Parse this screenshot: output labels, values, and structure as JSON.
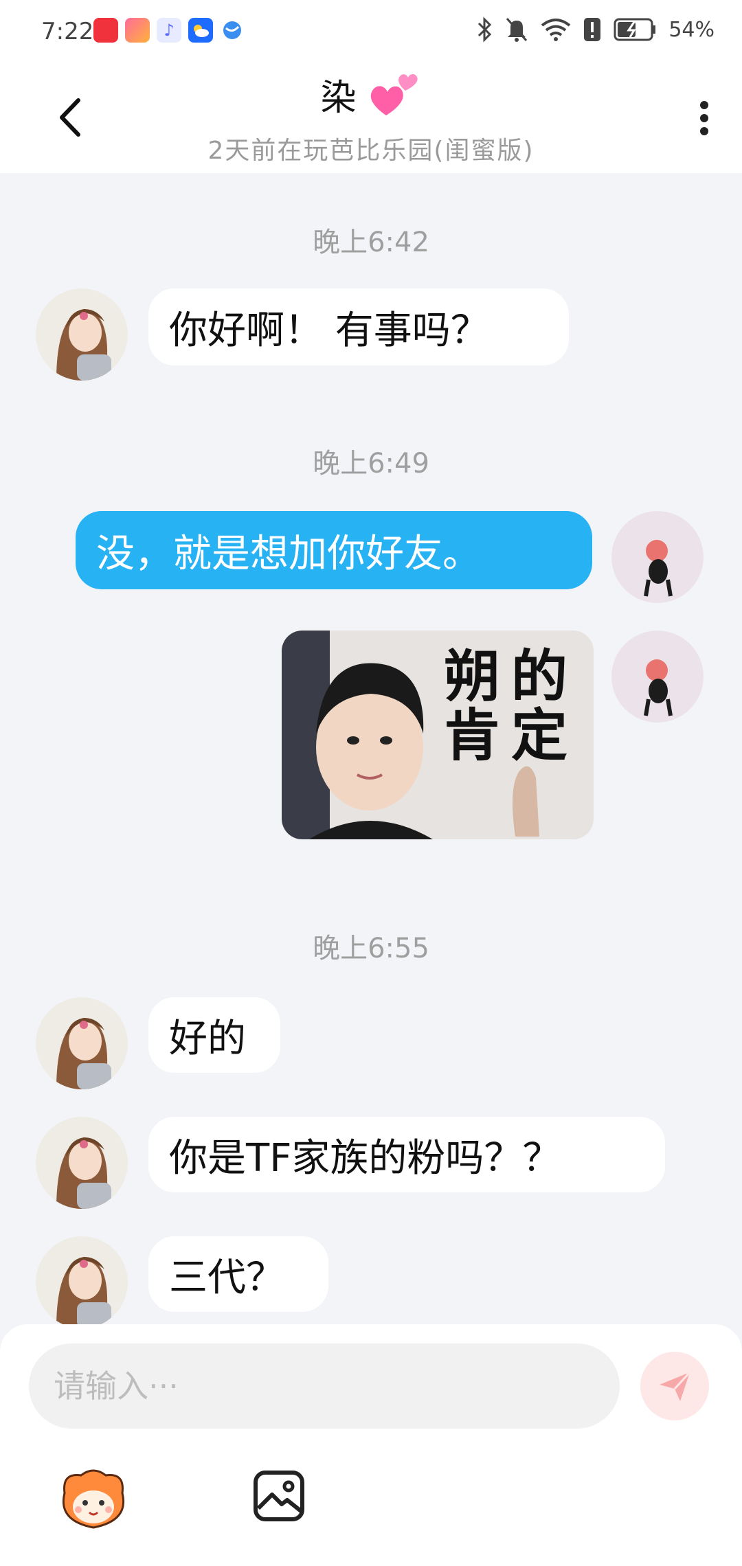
{
  "status_bar": {
    "time": "7:22",
    "battery": "54%",
    "icons": [
      "app-notif-icon",
      "gift-icon",
      "music-icon",
      "weather-icon",
      "browser-icon",
      "bluetooth-icon",
      "mute-icon",
      "wifi-icon",
      "alert-icon",
      "battery-icon"
    ]
  },
  "header": {
    "title": "染",
    "subtitle": "2天前在玩芭比乐园(闺蜜版)"
  },
  "messages": [
    {
      "type": "timestamp",
      "text": "晚上6:42"
    },
    {
      "type": "text",
      "direction": "in",
      "text": "你好啊！ 有事吗？"
    },
    {
      "type": "timestamp",
      "text": "晚上6:49"
    },
    {
      "type": "text",
      "direction": "out",
      "text": "没，就是想加你好友。"
    },
    {
      "type": "sticker",
      "direction": "out",
      "text_line1": "朔的",
      "text_line2": "肯定"
    },
    {
      "type": "timestamp",
      "text": "晚上6:55"
    },
    {
      "type": "text",
      "direction": "in",
      "text": "好的"
    },
    {
      "type": "text",
      "direction": "in",
      "text": "你是TF家族的粉吗？？"
    },
    {
      "type": "text",
      "direction": "in",
      "text": "三代？"
    }
  ],
  "input": {
    "placeholder": "请输入···"
  },
  "colors": {
    "outgoing_bubble": "#27b2f4",
    "incoming_bubble": "#ffffff",
    "chat_background": "#f2f4f7",
    "send_button": "#fde7e7"
  }
}
